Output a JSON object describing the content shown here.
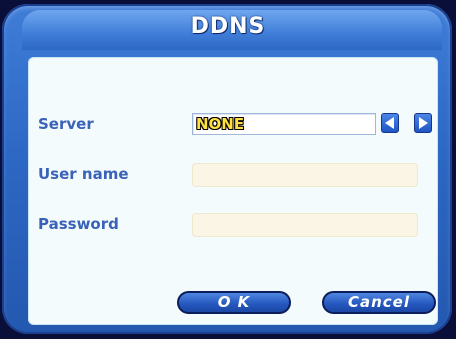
{
  "dialog": {
    "title": "DDNS"
  },
  "form": {
    "server": {
      "label": "Server",
      "value": "NONE",
      "prev_icon": "triangle-left-icon",
      "next_icon": "triangle-right-icon"
    },
    "user_name": {
      "label": "User name",
      "value": ""
    },
    "password": {
      "label": "Password",
      "value": ""
    }
  },
  "buttons": {
    "ok_label": "O K",
    "cancel_label": "Cancel"
  },
  "colors": {
    "frame": "#2d68c4",
    "panel": "#f4fbfd",
    "label": "#3a62b8",
    "field": "#fbf5e6"
  }
}
